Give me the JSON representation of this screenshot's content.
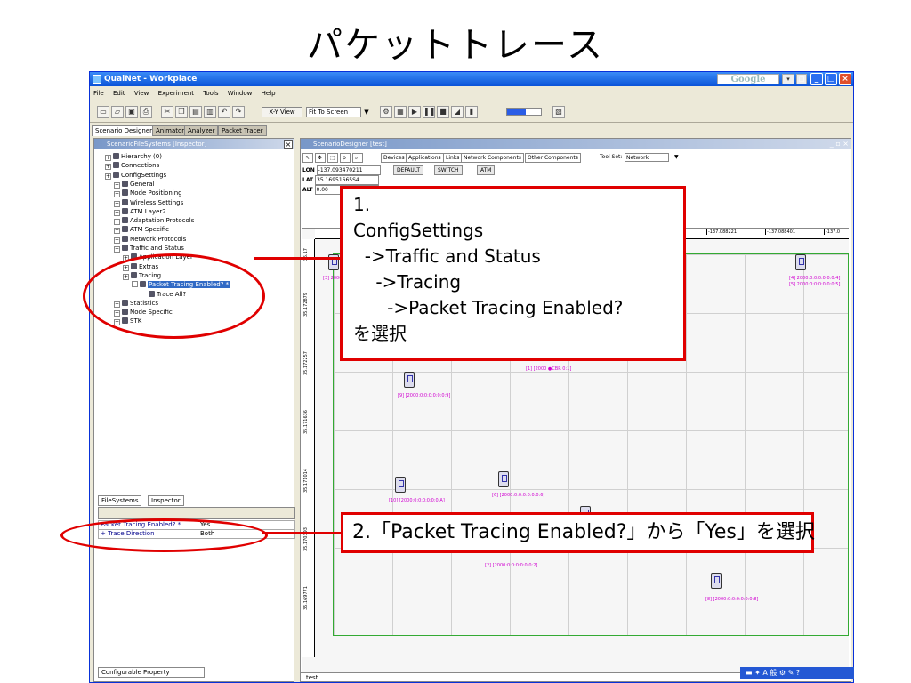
{
  "slide": {
    "title": "パケットトレース"
  },
  "window": {
    "title": "QualNet - Workplace",
    "search_placeholder": "Google"
  },
  "menu": [
    "File",
    "Edit",
    "View",
    "Experiment",
    "Tools",
    "Window",
    "Help"
  ],
  "toolbar": {
    "xy_view": "X-Y View",
    "fit_select": "Fit To Screen"
  },
  "progress": {
    "fraction": 0.55
  },
  "tabs": [
    "Scenario Designer",
    "Animator",
    "Analyzer",
    "Packet Tracer"
  ],
  "left_panel": {
    "header": "ScenarioFileSystems [Inspector]",
    "tree": [
      {
        "label": "Hierarchy (0)",
        "level": 1
      },
      {
        "label": "Connections",
        "level": 1
      },
      {
        "label": "ConfigSettings",
        "level": 1
      },
      {
        "label": "General",
        "level": 2
      },
      {
        "label": "Node Positioning",
        "level": 2
      },
      {
        "label": "Wireless Settings",
        "level": 2
      },
      {
        "label": "ATM Layer2",
        "level": 2
      },
      {
        "label": "Adaptation Protocols",
        "level": 2
      },
      {
        "label": "ATM Specific",
        "level": 2
      },
      {
        "label": "Network Protocols",
        "level": 2
      },
      {
        "label": "Traffic and Status",
        "level": 2
      },
      {
        "label": "Application Layer",
        "level": 3
      },
      {
        "label": "Extras",
        "level": 3
      },
      {
        "label": "Tracing",
        "level": 3
      },
      {
        "label": "Packet Tracing Enabled? *",
        "level": 4
      },
      {
        "label": "Trace All?",
        "level": 5
      },
      {
        "label": "Statistics",
        "level": 2
      },
      {
        "label": "Node Specific",
        "level": 2
      },
      {
        "label": "STK",
        "level": 2
      }
    ],
    "bottom_tabs": [
      "FileSystems",
      "Inspector"
    ],
    "properties": [
      {
        "key": "Packet Tracing Enabled? *",
        "value": "Yes"
      },
      {
        "key": "+ Trace Direction",
        "value": "Both"
      }
    ],
    "status": "Configurable Property"
  },
  "right_panel": {
    "header": "ScenarioDesigner [test]",
    "component_tabs": [
      "Devices",
      "Applications",
      "Links",
      "Network Components",
      "Other Components"
    ],
    "toolset_label": "Tool Set:",
    "toolset_value": "Network",
    "device_buttons": [
      "DEFAULT",
      "SWITCH",
      "ATM"
    ],
    "coords": [
      {
        "label": "LON",
        "value": "-137.093470211"
      },
      {
        "label": "LAT",
        "value": "35.16951665S4"
      },
      {
        "label": "ALT",
        "value": "0.00"
      }
    ],
    "ruler_top": [
      "-137.088221",
      "-137.088401",
      "-137.0"
    ],
    "ruler_left": [
      "35.17",
      "35.172879",
      "35.172257",
      "35.171636",
      "35.171014",
      "35.170393",
      "35.169771"
    ],
    "nodes": [
      {
        "label": "[3] 2000:"
      },
      {
        "label": "[4] 2000:0:0:0:0:0:0:4]"
      },
      {
        "label": "[5] 2000:0:0:0:0:0:0:5]"
      },
      {
        "label": "[9] [2000:0:0:0:0:0:0:9]"
      },
      {
        "label": "[1] [2000 ●CBR 0:1]"
      },
      {
        "label": "[10] [2000:0:0:0:0:0:0:A]"
      },
      {
        "label": "[6] [2000:0:0:0:0:0:0:6]"
      },
      {
        "label": "[2] [2000:0:0:0:0:0:0:2]"
      },
      {
        "label": "[8] [2000:0:0:0:0:0:0:8]"
      }
    ],
    "status": "test"
  },
  "callouts": {
    "one": [
      "1.",
      "ConfigSettings",
      "  ->Traffic and Status",
      "    ->Tracing",
      "      ->Packet Tracing Enabled?",
      "を選択"
    ],
    "two": "2.「Packet Tracing Enabled?」から「Yes」を選択"
  },
  "colors": {
    "callout": "#e00000",
    "titlebar": "#0a53d8",
    "selection": "#316ac5",
    "node_label": "#d000d0"
  }
}
